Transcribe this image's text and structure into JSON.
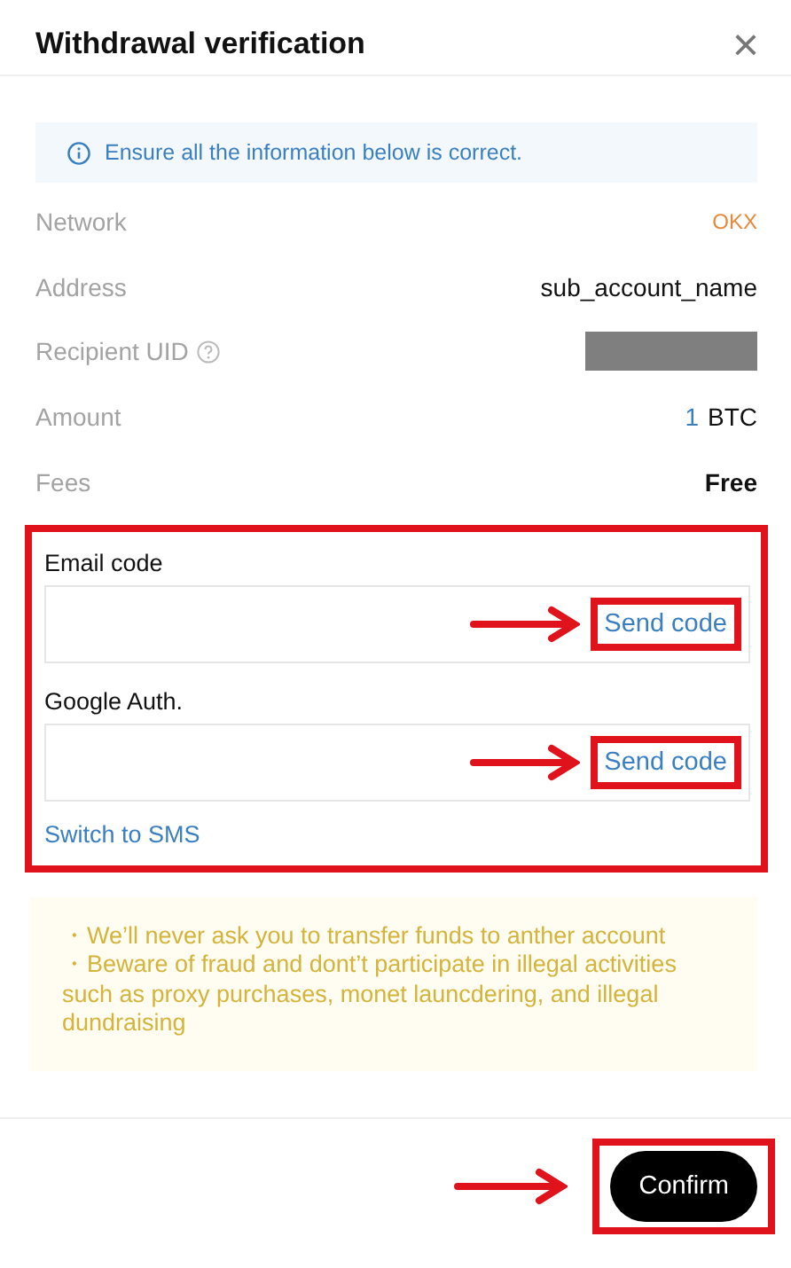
{
  "dialog": {
    "title": "Withdrawal verification",
    "close": "×"
  },
  "notice": "Ensure all the information below is correct.",
  "details": [
    {
      "kind": "tag",
      "label": "Network",
      "value": "OKX"
    },
    {
      "kind": "text",
      "label": "Address",
      "value": "sub_account_name"
    },
    {
      "kind": "redacted",
      "label": "Recipient UID",
      "help": true
    },
    {
      "kind": "amount",
      "label": "Amount",
      "amount": "1",
      "unit": "BTC"
    },
    {
      "kind": "strong",
      "label": "Fees",
      "value": "Free"
    }
  ],
  "verification": {
    "highlighted": true,
    "fields": [
      {
        "label": "Email code",
        "button": "Send code",
        "highlighted": true
      },
      {
        "label": "Google Auth.",
        "button": "Send code",
        "highlighted": true
      }
    ],
    "switch_link": "Switch to SMS"
  },
  "warnings": [
    "・We’ll never ask you to transfer funds to anther account",
    "・Beware of fraud and dont’t participate in illegal activities such as proxy purchases, monet launcdering, and illegal dundraising"
  ],
  "confirm": {
    "label": "Confirm",
    "highlighted": true
  }
}
